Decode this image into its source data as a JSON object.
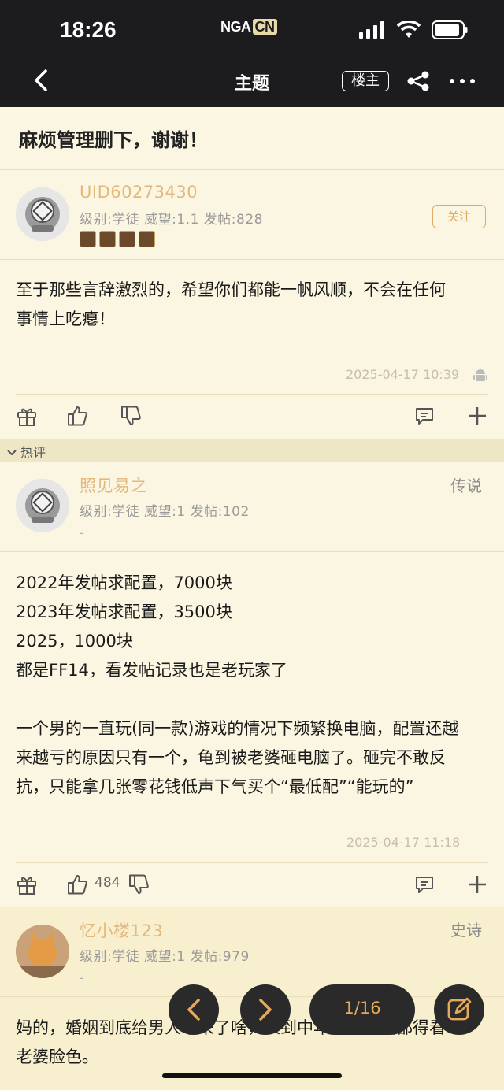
{
  "status_bar": {
    "time": "18:26",
    "logo_main": "NGA",
    "logo_cn": "CN"
  },
  "nav": {
    "title": "主题",
    "louzhu": "楼主"
  },
  "thread": {
    "title": "麻烦管理删下，谢谢！"
  },
  "posts": [
    {
      "username": "UID60273430",
      "meta": "级别:学徒  威望:1.1  发帖:828",
      "follow_label": "关注",
      "content": [
        "至于那些言辞激烈的，希望你们都能一帆风顺，不会在任何",
        "事情上吃瘪！"
      ],
      "time": "2025-04-17 10:39"
    },
    {
      "username": "照见易之",
      "meta": "级别:学徒  威望:1  发帖:102",
      "dash": "-",
      "tag": "传说",
      "content": [
        "2022年发帖求配置，7000块",
        "2023年发帖求配置，3500块",
        "2025，1000块",
        "都是FF14，看发帖记录也是老玩家了",
        "",
        "一个男的一直玩(同一款)游戏的情况下频繁换电脑，配置还越",
        "来越亏的原因只有一个，龟到被老婆砸电脑了。砸完不敢反",
        "抗，只能拿几张零花钱低声下气买个“最低配”“能玩的”"
      ],
      "time": "2025-04-17 11:18",
      "like_count": "484"
    },
    {
      "username": "忆小楼123",
      "meta": "级别:学徒  威望:1  发帖:979",
      "dash": "-",
      "tag": "史诗",
      "content": [
        "妈的，婚姻到底给男人带来了啥，人到中年买个电脑都得看",
        "老婆脸色。"
      ]
    }
  ],
  "hot_section": {
    "label": "热评"
  },
  "pager": {
    "label": "1/16"
  },
  "colors": {
    "accent": "#e4b77a",
    "bg": "#fbf6e1",
    "topbar": "#1c1c1e"
  }
}
